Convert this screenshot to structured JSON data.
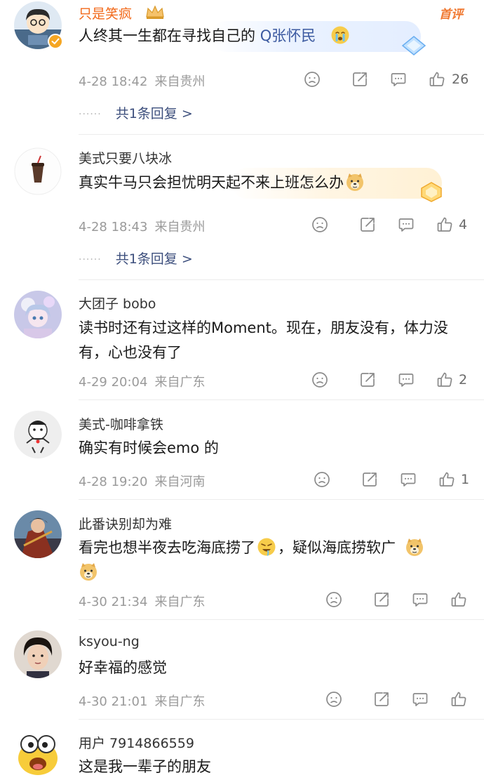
{
  "comments": [
    {
      "username": "只是笑疯",
      "first_tag": "首评",
      "text_before": "人终其一生都在寻找自己的 ",
      "topic": "Q张怀民",
      "date": "4-28 18:42",
      "location": "来自贵州",
      "likes": "26",
      "replies": "共1条回复 >"
    },
    {
      "username": "美式只要八块冰",
      "text": "真实牛马只会担忧明天起不来上班怎么办",
      "date": "4-28 18:43",
      "location": "来自贵州",
      "likes": "4",
      "replies": "共1条回复 >"
    },
    {
      "username": "大团子 bobo",
      "text": "读书时还有过这样的Moment。现在，朋友没有，体力没有，心也没有了",
      "date": "4-29 20:04",
      "location": "来自广东",
      "likes": "2"
    },
    {
      "username": "美式-咖啡拿铁",
      "text": "确实有时候会emo 的",
      "date": "4-28 19:20",
      "location": "来自河南",
      "likes": "1"
    },
    {
      "username": "此番诀别却为难",
      "text_a": "看完也想半夜去吃海底捞了",
      "text_b": "，疑似海底捞软广",
      "date": "4-30 21:34",
      "location": "来自广东"
    },
    {
      "username": "ksyou-ng",
      "text": "好幸福的感觉",
      "date": "4-30 21:01",
      "location": "来自广东"
    },
    {
      "username": "用户 7914866559",
      "text": "这是我一辈子的朋友"
    }
  ],
  "reply_dots": "······",
  "colors": {
    "vip_name": "#f26a1b",
    "topic": "#3c5aa0",
    "meta": "#9a9a9a"
  },
  "icons": [
    "dislike-icon",
    "repost-icon",
    "comment-icon",
    "like-icon"
  ]
}
